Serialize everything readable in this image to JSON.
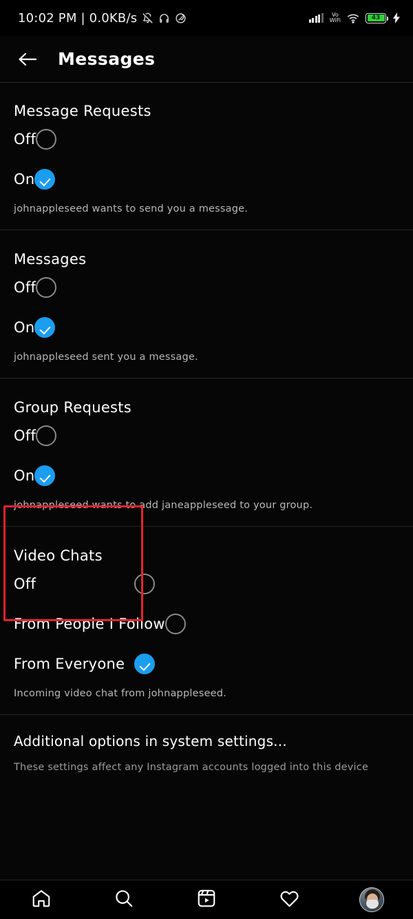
{
  "statusbar": {
    "time_text": "10:02 PM | 0.0KB/s",
    "icons_left": [
      "bell-muted-icon",
      "headphones-icon",
      "dnd-icon"
    ],
    "signal_icon": "signal-bars-icon",
    "volte_line1": "Vo",
    "volte_line2": "WiFi",
    "wifi_icon": "wifi-icon",
    "battery_level": "43",
    "charging_icon": "charging-bolt-icon",
    "battery_color": "#2fd03a"
  },
  "header": {
    "back_icon": "back-arrow-icon",
    "title": "Messages"
  },
  "theme": {
    "accent_blue": "#1b9df0",
    "highlight_red": "#e8222e",
    "background": "#060606"
  },
  "sections": [
    {
      "title": "Message Requests",
      "description": "johnappleseed wants to send you a message.",
      "options": [
        {
          "label": "Off",
          "checked": false
        },
        {
          "label": "On",
          "checked": true
        }
      ]
    },
    {
      "title": "Messages",
      "description": "johnappleseed sent you a message.",
      "options": [
        {
          "label": "Off",
          "checked": false
        },
        {
          "label": "On",
          "checked": true
        }
      ]
    },
    {
      "title": "Group Requests",
      "description": "johnappleseed wants to add janeappleseed to your group.",
      "highlighted": true,
      "options": [
        {
          "label": "Off",
          "checked": false
        },
        {
          "label": "On",
          "checked": true
        }
      ]
    },
    {
      "title": "Video Chats",
      "description": "Incoming video chat from johnappleseed.",
      "aligned": true,
      "options": [
        {
          "label": "Off",
          "checked": false
        },
        {
          "label": "From People I Follow",
          "checked": false
        },
        {
          "label": "From Everyone",
          "checked": true
        }
      ]
    }
  ],
  "footer": {
    "title": "Additional options in system settings...",
    "description": "These settings affect any Instagram accounts logged into this device"
  },
  "bottom_nav": [
    {
      "icon": "home-icon",
      "label": "Home"
    },
    {
      "icon": "search-icon",
      "label": "Search"
    },
    {
      "icon": "reels-icon",
      "label": "Reels"
    },
    {
      "icon": "heart-icon",
      "label": "Activity"
    },
    {
      "icon": "profile-avatar-icon",
      "label": "Profile"
    }
  ]
}
